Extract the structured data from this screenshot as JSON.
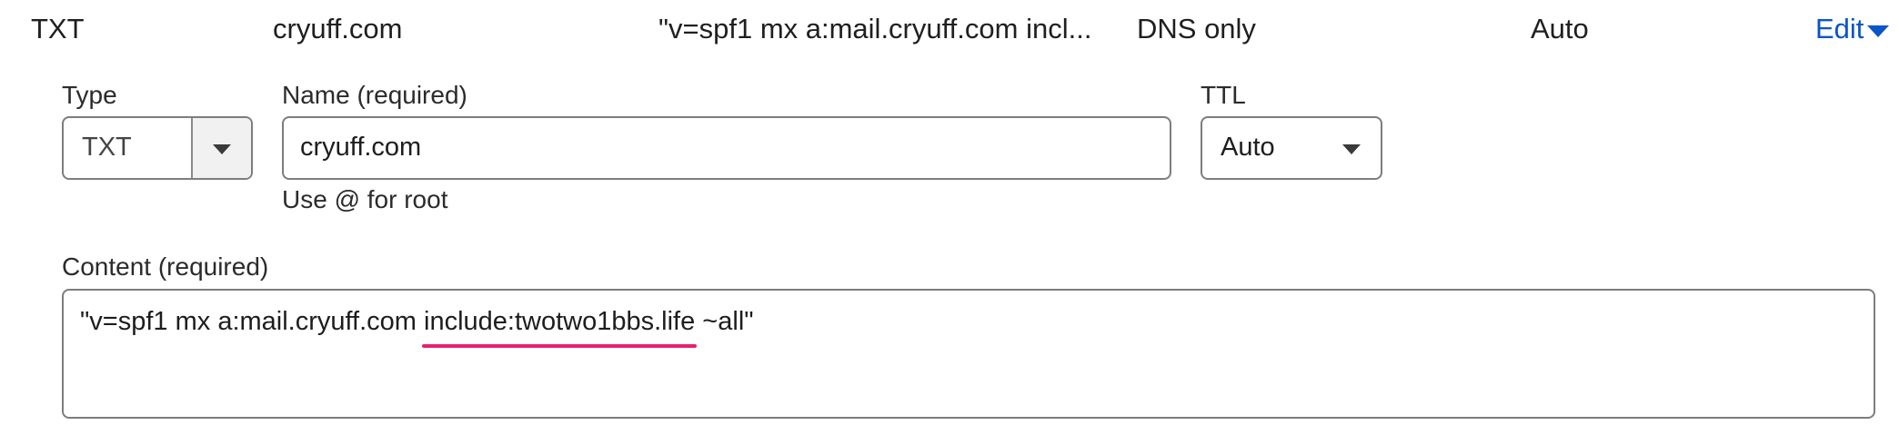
{
  "record_row": {
    "type": "TXT",
    "name": "cryuff.com",
    "content_preview": "\"v=spf1 mx a:mail.cryuff.com incl...",
    "proxy_status": "DNS only",
    "ttl": "Auto",
    "edit_label": "Edit"
  },
  "form": {
    "type_label": "Type",
    "type_value": "TXT",
    "name_label": "Name (required)",
    "name_value": "cryuff.com",
    "name_hint": "Use @ for root",
    "ttl_label": "TTL",
    "ttl_value": "Auto",
    "content_label": "Content (required)",
    "content_before": "\"v=spf1 mx a:mail.cryuff.com ",
    "content_highlight": "include:twotwo1bbs.life",
    "content_after": " ~all\""
  },
  "colors": {
    "link": "#0a55c8",
    "annotation_underline": "#e8206f"
  }
}
